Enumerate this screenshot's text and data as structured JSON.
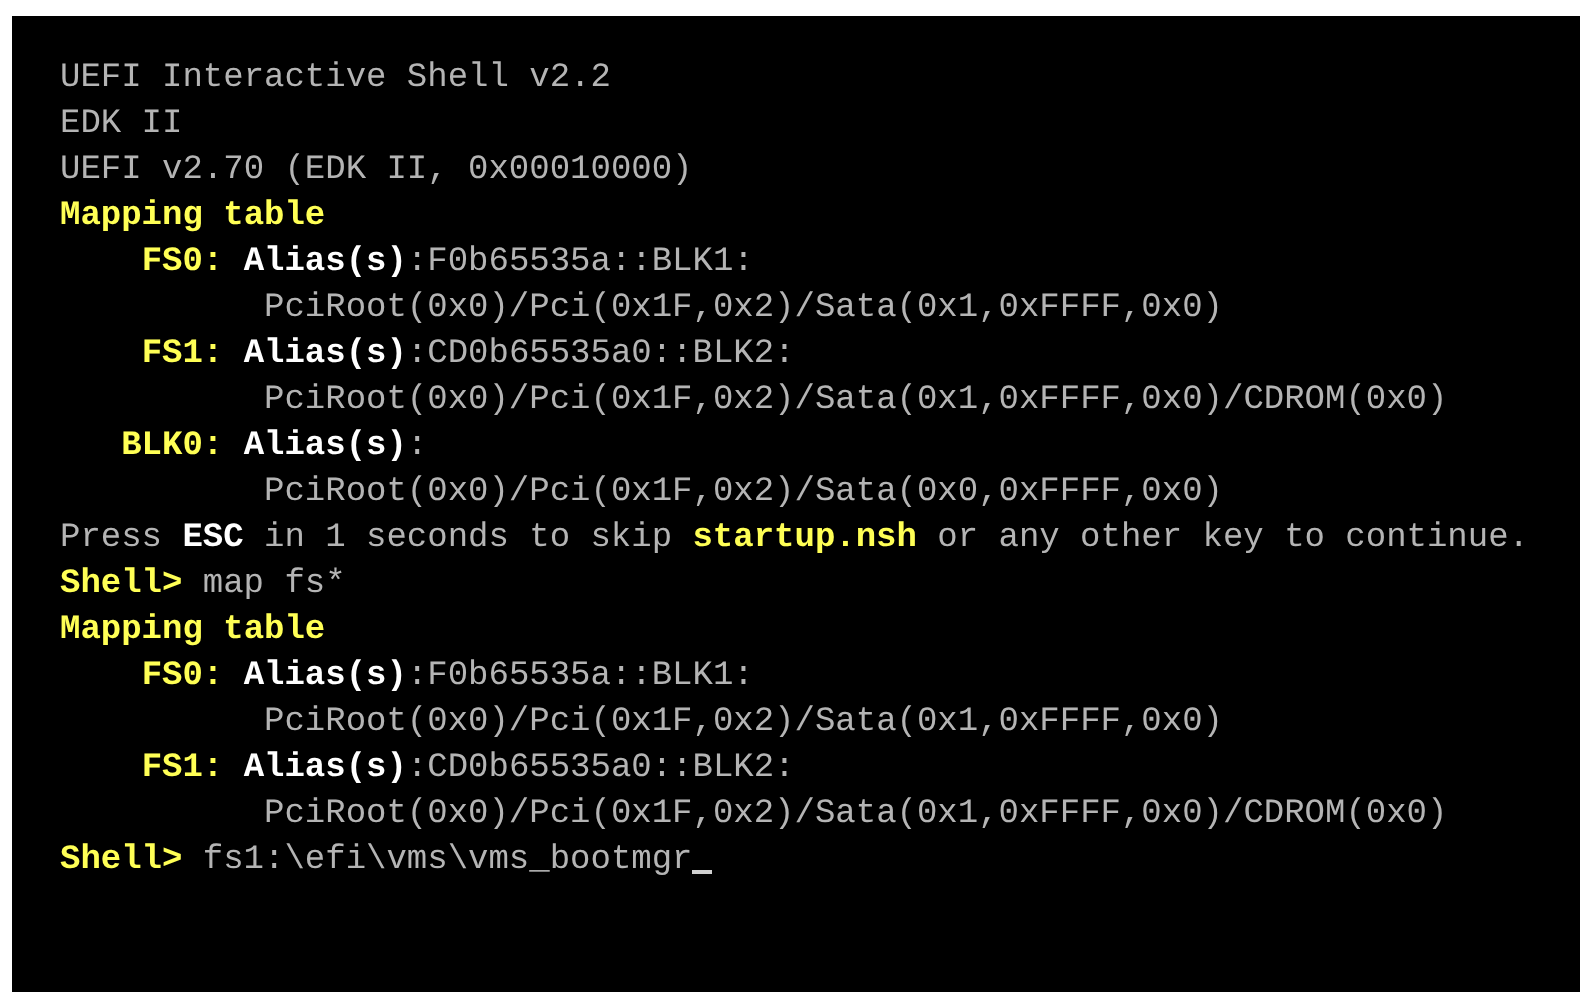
{
  "console": {
    "lines": [
      {
        "kind": "text",
        "segments": [
          {
            "color": "#b4b4b4",
            "bold": false,
            "text": "UEFI Interactive Shell v2.2"
          }
        ]
      },
      {
        "kind": "text",
        "segments": [
          {
            "color": "#b4b4b4",
            "bold": false,
            "text": "EDK II"
          }
        ]
      },
      {
        "kind": "text",
        "segments": [
          {
            "color": "#b4b4b4",
            "bold": false,
            "text": "UEFI v2.70 (EDK II, 0x00010000)"
          }
        ]
      },
      {
        "kind": "text",
        "segments": [
          {
            "color": "#ffff55",
            "bold": true,
            "text": "Mapping table"
          }
        ]
      },
      {
        "kind": "entry",
        "segments": [
          {
            "color": "#ffff55",
            "bold": true,
            "text": "FS0:"
          },
          {
            "color": "#ffffff",
            "bold": true,
            "text": "Alias(s)"
          },
          {
            "color": "#b4b4b4",
            "bold": false,
            "text": ":F0b65535a::BLK1:"
          }
        ]
      },
      {
        "kind": "path",
        "segments": [
          {
            "color": "#b4b4b4",
            "bold": false,
            "text": "PciRoot(0x0)/Pci(0x1F,0x2)/Sata(0x1,0xFFFF,0x0)"
          }
        ]
      },
      {
        "kind": "entry",
        "segments": [
          {
            "color": "#ffff55",
            "bold": true,
            "text": "FS1:"
          },
          {
            "color": "#ffffff",
            "bold": true,
            "text": "Alias(s)"
          },
          {
            "color": "#b4b4b4",
            "bold": false,
            "text": ":CD0b65535a0::BLK2:"
          }
        ]
      },
      {
        "kind": "path",
        "segments": [
          {
            "color": "#b4b4b4",
            "bold": false,
            "text": "PciRoot(0x0)/Pci(0x1F,0x2)/Sata(0x1,0xFFFF,0x0)/CDROM(0x0)"
          }
        ]
      },
      {
        "kind": "entry",
        "segments": [
          {
            "color": "#ffff55",
            "bold": true,
            "text": "BLK0:"
          },
          {
            "color": "#ffffff",
            "bold": true,
            "text": "Alias(s)"
          },
          {
            "color": "#b4b4b4",
            "bold": false,
            "text": ":"
          }
        ]
      },
      {
        "kind": "path",
        "segments": [
          {
            "color": "#b4b4b4",
            "bold": false,
            "text": "PciRoot(0x0)/Pci(0x1F,0x2)/Sata(0x0,0xFFFF,0x0)"
          }
        ]
      },
      {
        "kind": "text",
        "segments": [
          {
            "color": "#b4b4b4",
            "bold": false,
            "text": "Press"
          },
          {
            "color": "#ffffff",
            "bold": true,
            "text": "ESC"
          },
          {
            "color": "#b4b4b4",
            "bold": false,
            "text": "in 1 seconds to skip"
          },
          {
            "color": "#ffff55",
            "bold": true,
            "text": "startup.nsh"
          },
          {
            "color": "#b4b4b4",
            "bold": false,
            "text": "or any other key to continue."
          }
        ]
      },
      {
        "kind": "text",
        "segments": [
          {
            "color": "#ffff55",
            "bold": true,
            "text": "Shell>"
          },
          {
            "color": "#b4b4b4",
            "bold": false,
            "text": "map fs*"
          }
        ]
      },
      {
        "kind": "text",
        "segments": [
          {
            "color": "#ffff55",
            "bold": true,
            "text": "Mapping table"
          }
        ]
      },
      {
        "kind": "entry",
        "segments": [
          {
            "color": "#ffff55",
            "bold": true,
            "text": "FS0:"
          },
          {
            "color": "#ffffff",
            "bold": true,
            "text": "Alias(s)"
          },
          {
            "color": "#b4b4b4",
            "bold": false,
            "text": ":F0b65535a::BLK1:"
          }
        ]
      },
      {
        "kind": "path",
        "segments": [
          {
            "color": "#b4b4b4",
            "bold": false,
            "text": "PciRoot(0x0)/Pci(0x1F,0x2)/Sata(0x1,0xFFFF,0x0)"
          }
        ]
      },
      {
        "kind": "entry",
        "segments": [
          {
            "color": "#ffff55",
            "bold": true,
            "text": "FS1:"
          },
          {
            "color": "#ffffff",
            "bold": true,
            "text": "Alias(s)"
          },
          {
            "color": "#b4b4b4",
            "bold": false,
            "text": ":CD0b65535a0::BLK2:"
          }
        ]
      },
      {
        "kind": "path",
        "segments": [
          {
            "color": "#b4b4b4",
            "bold": false,
            "text": "PciRoot(0x0)/Pci(0x1F,0x2)/Sata(0x1,0xFFFF,0x0)/CDROM(0x0)"
          }
        ]
      },
      {
        "kind": "prompt",
        "segments": [
          {
            "color": "#ffff55",
            "bold": true,
            "text": "Shell>"
          },
          {
            "color": "#b4b4b4",
            "bold": false,
            "text": "fs1:\\efi\\vms\\vms_bootmgr"
          }
        ]
      }
    ]
  }
}
